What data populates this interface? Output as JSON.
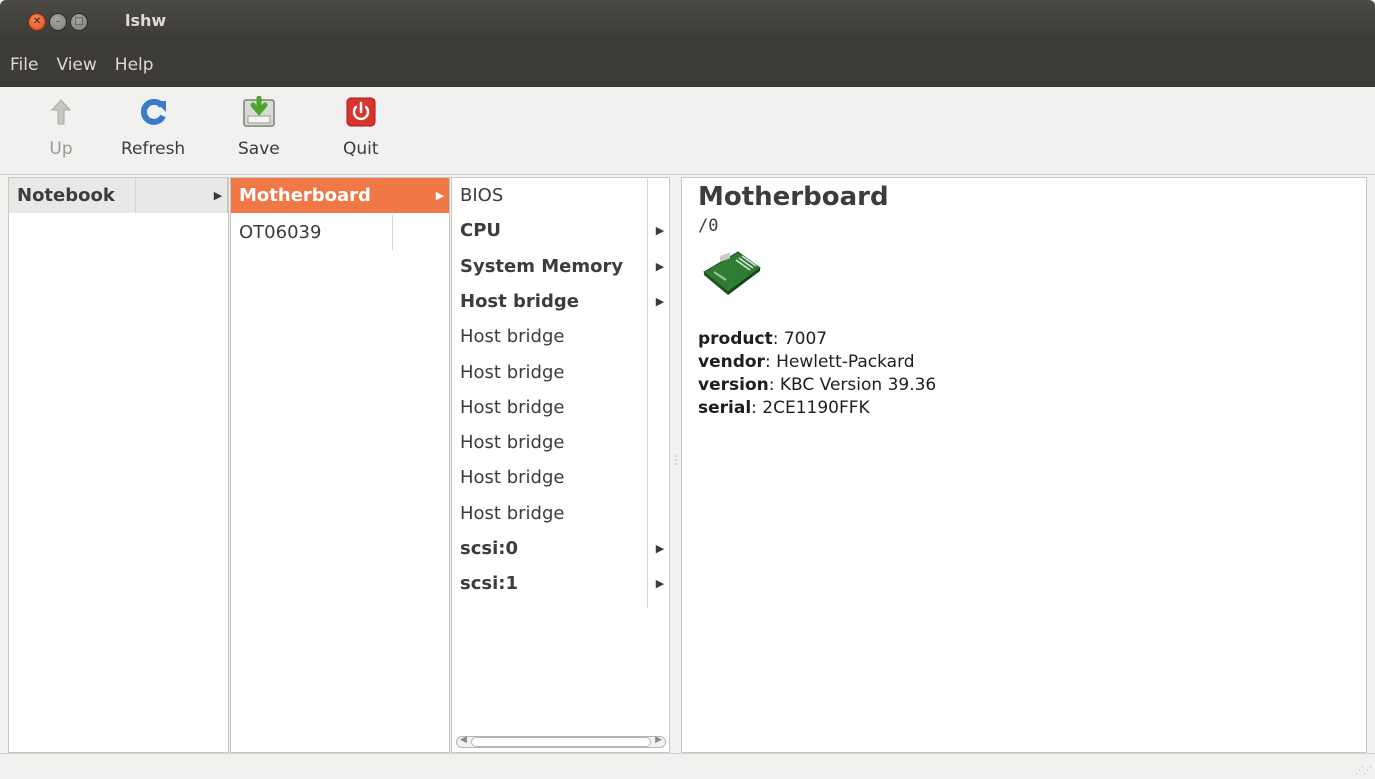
{
  "window": {
    "title": "lshw"
  },
  "menu": [
    "File",
    "View",
    "Help"
  ],
  "toolbar": {
    "up_label": "Up",
    "refresh_label": "Refresh",
    "save_label": "Save",
    "quit_label": "Quit"
  },
  "column1": {
    "header": "Notebook"
  },
  "column2": {
    "items": [
      "Motherboard",
      "OT06039"
    ]
  },
  "column3": {
    "items": [
      {
        "label": "BIOS",
        "bold": false,
        "arrow": false
      },
      {
        "label": "CPU",
        "bold": true,
        "arrow": true
      },
      {
        "label": "System Memory",
        "bold": true,
        "arrow": true
      },
      {
        "label": "Host bridge",
        "bold": true,
        "arrow": true
      },
      {
        "label": "Host bridge",
        "bold": false,
        "arrow": false
      },
      {
        "label": "Host bridge",
        "bold": false,
        "arrow": false
      },
      {
        "label": "Host bridge",
        "bold": false,
        "arrow": false
      },
      {
        "label": "Host bridge",
        "bold": false,
        "arrow": false
      },
      {
        "label": "Host bridge",
        "bold": false,
        "arrow": false
      },
      {
        "label": "Host bridge",
        "bold": false,
        "arrow": false
      },
      {
        "label": "scsi:0",
        "bold": true,
        "arrow": true
      },
      {
        "label": "scsi:1",
        "bold": true,
        "arrow": true
      }
    ]
  },
  "detail": {
    "title": "Motherboard",
    "path": "/0",
    "properties": [
      {
        "key": "product",
        "value": ": 7007"
      },
      {
        "key": "vendor",
        "value": ": Hewlett-Packard"
      },
      {
        "key": "version",
        "value": ": KBC Version 39.36"
      },
      {
        "key": "serial",
        "value": ": 2CE1190FFK"
      }
    ]
  },
  "colors": {
    "selection": "#f07746",
    "titlebar": "#3c3b37",
    "close_button": "#dd4814"
  },
  "icons": {
    "close": "close-icon",
    "minimize": "minimize-icon",
    "maximize": "maximize-icon",
    "up": "arrow-up-icon",
    "refresh": "refresh-icon",
    "save": "save-icon",
    "quit": "power-icon",
    "motherboard": "motherboard-icon"
  }
}
